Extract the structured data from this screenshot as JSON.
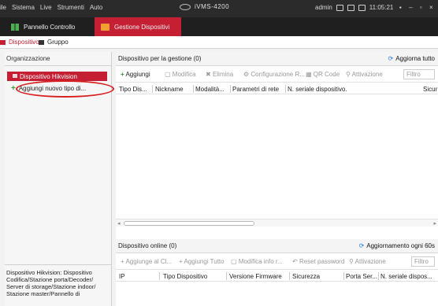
{
  "menubar": {
    "items": [
      "ile",
      "Sistema",
      "Live",
      "Strumenti",
      "Auto"
    ],
    "app_title": "iVMS-4200",
    "user": "admin",
    "time": "11:05:21",
    "window_buttons": [
      "▪",
      "–",
      "▫",
      "×"
    ]
  },
  "tabs": [
    {
      "label": "Pannello Controllo"
    },
    {
      "label": "Gestione Dispositivi"
    }
  ],
  "subtabs": [
    {
      "label": "Dispositivo"
    },
    {
      "label": "Gruppo"
    }
  ],
  "left_panel": {
    "header": "Organizzazione",
    "selected_item": "Dispositivo Hikvision",
    "add_item": "Aggiungi nuovo tipo di...",
    "description": "Dispositivo Hikvision: Dispositivo Codifica/Stazione porta/Decoder/ Server di storage/Stazione indoor/ Stazione master/Pannello di"
  },
  "managed": {
    "title": "Dispositivo per la gestione (0)",
    "action": "Aggiorna tutto",
    "toolbar": [
      "Aggiungi",
      "Modifica",
      "Elimina",
      "Configurazione R...",
      "QR Code",
      "Attivazione"
    ],
    "filter_placeholder": "Filtro",
    "columns": [
      "Tipo Dis...",
      "Nickname",
      "Modalità...",
      "Parametri di rete",
      "N. seriale dispositivo.",
      "Sicur"
    ]
  },
  "online": {
    "title": "Dispositivo online (0)",
    "action": "Aggiornamento ogni 60s",
    "toolbar": [
      "Aggiunge al Cl...",
      "Aggiungi Tutto",
      "Modifica info r...",
      "Reset password",
      "Attivazione"
    ],
    "filter_placeholder": "Filtro",
    "columns": [
      "IP",
      "Tipo Dispositivo",
      "Versione Firmware",
      "Sicurezza",
      "Porta Ser...",
      "N. seriale dispos..."
    ]
  },
  "colors": {
    "accent": "#c41f32",
    "topbar": "#2b2b2b",
    "tabbar": "#1f1f1f",
    "link_blue": "#2a7de1",
    "annotation_red": "#d81f1f"
  }
}
